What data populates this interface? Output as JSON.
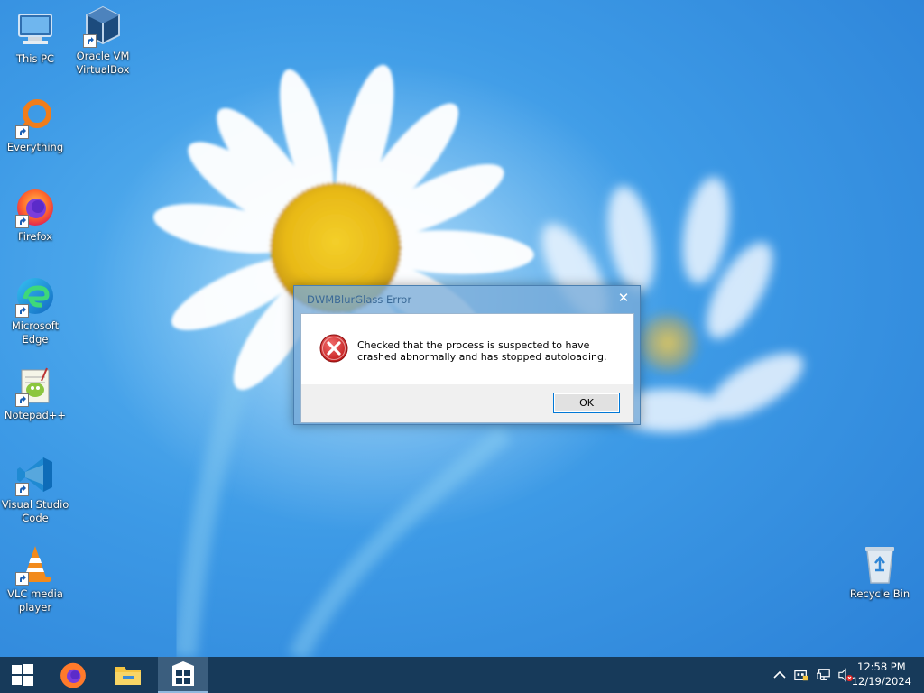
{
  "desktop": {
    "icons": [
      {
        "label": "This PC",
        "icon": "computer-icon"
      },
      {
        "label": "Oracle VM\nVirtualBox",
        "icon": "virtualbox-icon"
      },
      {
        "label": "Everything",
        "icon": "everything-search-icon"
      },
      {
        "label": "Firefox",
        "icon": "firefox-icon"
      },
      {
        "label": "Microsoft\nEdge",
        "icon": "edge-icon"
      },
      {
        "label": "Notepad++",
        "icon": "notepadpp-icon"
      },
      {
        "label": "Visual Studio\nCode",
        "icon": "vscode-icon"
      },
      {
        "label": "VLC media\nplayer",
        "icon": "vlc-icon"
      },
      {
        "label": "Recycle Bin",
        "icon": "recycle-bin-icon"
      }
    ]
  },
  "dialog": {
    "title": "DWMBlurGlass Error",
    "close_glyph": "✕",
    "message": "Checked that the process is suspected to have crashed abnormally and has stopped autoloading.",
    "ok_label": "OK",
    "icon": "error-icon"
  },
  "taskbar": {
    "start_icon": "windows-start-icon",
    "pinned": [
      "firefox-icon",
      "file-explorer-icon",
      "app-grid-icon"
    ],
    "tray": {
      "chevron": "^",
      "icons": [
        "keyboard-icon",
        "network-icon",
        "volume-muted-icon"
      ]
    },
    "clock": {
      "time": "12:58 PM",
      "date": "12/19/2024"
    }
  },
  "colors": {
    "taskbar": "#173a5a",
    "accent": "#0078d7",
    "error_red": "#d32f2f"
  }
}
